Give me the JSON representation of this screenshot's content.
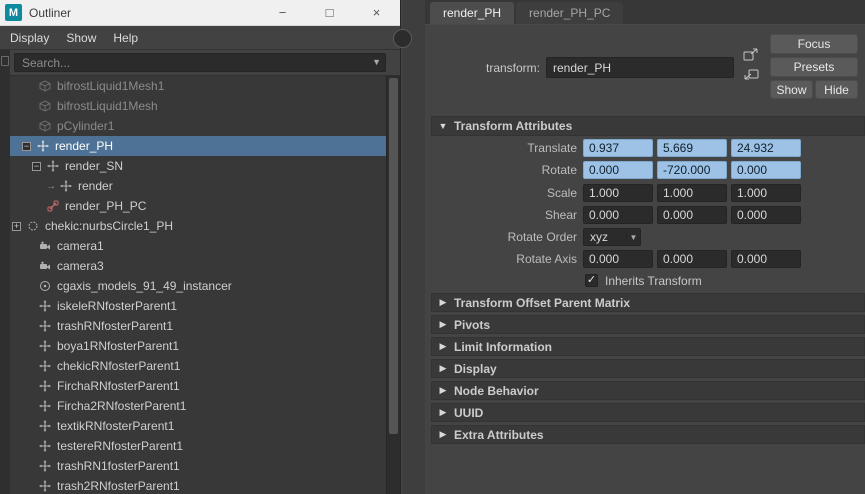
{
  "window": {
    "title": "Outliner"
  },
  "icons": {
    "minimize": "−",
    "maximize": "□",
    "close": "×",
    "dropdown_arrow": "▼",
    "section_expanded": "▼",
    "section_collapsed": "▶",
    "expander_open": "−",
    "expander_closed": "+",
    "child_arrow": "→",
    "checkmark": "✓",
    "maya_logo_letter": "M"
  },
  "colors": {
    "selection_blue": "#4e7296",
    "field_highlight_blue": "#9dc2e5",
    "reference_red": "#c46a6a",
    "titlebar": "#f0f0f0"
  },
  "outliner": {
    "menu": [
      "Display",
      "Show",
      "Help"
    ],
    "search_placeholder": "Search...",
    "items": [
      {
        "label": "bifrostLiquid1Mesh1"
      },
      {
        "label": "bifrostLiquid1Mesh"
      },
      {
        "label": "pCylinder1"
      },
      {
        "label": "render_PH"
      },
      {
        "label": "render_SN"
      },
      {
        "label": "render"
      },
      {
        "label": "render_PH_PC"
      },
      {
        "label": "chekic:nurbsCircle1_PH"
      },
      {
        "label": "camera1"
      },
      {
        "label": "camera3"
      },
      {
        "label": "cgaxis_models_91_49_instancer"
      },
      {
        "label": "iskeleRNfosterParent1"
      },
      {
        "label": "trashRNfosterParent1"
      },
      {
        "label": "boya1RNfosterParent1"
      },
      {
        "label": "chekicRNfosterParent1"
      },
      {
        "label": "FirchaRNfosterParent1"
      },
      {
        "label": "Fircha2RNfosterParent1"
      },
      {
        "label": "textikRNfosterParent1"
      },
      {
        "label": "testereRNfosterParent1"
      },
      {
        "label": "trashRN1fosterParent1"
      },
      {
        "label": "trash2RNfosterParent1"
      }
    ]
  },
  "attribute_editor": {
    "tabs": [
      {
        "label": "render_PH"
      },
      {
        "label": "render_PH_PC"
      }
    ],
    "transform": {
      "label": "transform:",
      "value": "render_PH"
    },
    "buttons": {
      "focus": "Focus",
      "presets": "Presets",
      "show": "Show",
      "hide": "Hide"
    },
    "transform_attributes": {
      "title": "Transform Attributes",
      "translate": {
        "label": "Translate",
        "values": [
          "0.937",
          "5.669",
          "24.932"
        ]
      },
      "rotate": {
        "label": "Rotate",
        "values": [
          "0.000",
          "-720.000",
          "0.000"
        ]
      },
      "scale": {
        "label": "Scale",
        "values": [
          "1.000",
          "1.000",
          "1.000"
        ]
      },
      "shear": {
        "label": "Shear",
        "values": [
          "0.000",
          "0.000",
          "0.000"
        ]
      },
      "rotate_order": {
        "label": "Rotate Order",
        "value": "xyz"
      },
      "rotate_axis": {
        "label": "Rotate Axis",
        "values": [
          "0.000",
          "0.000",
          "0.000"
        ]
      },
      "inherits_transform": {
        "label": "Inherits Transform",
        "checked": true
      }
    },
    "sections": [
      {
        "title": "Transform Offset Parent Matrix"
      },
      {
        "title": "Pivots"
      },
      {
        "title": "Limit Information"
      },
      {
        "title": "Display"
      },
      {
        "title": "Node Behavior"
      },
      {
        "title": "UUID"
      },
      {
        "title": "Extra Attributes"
      }
    ]
  }
}
